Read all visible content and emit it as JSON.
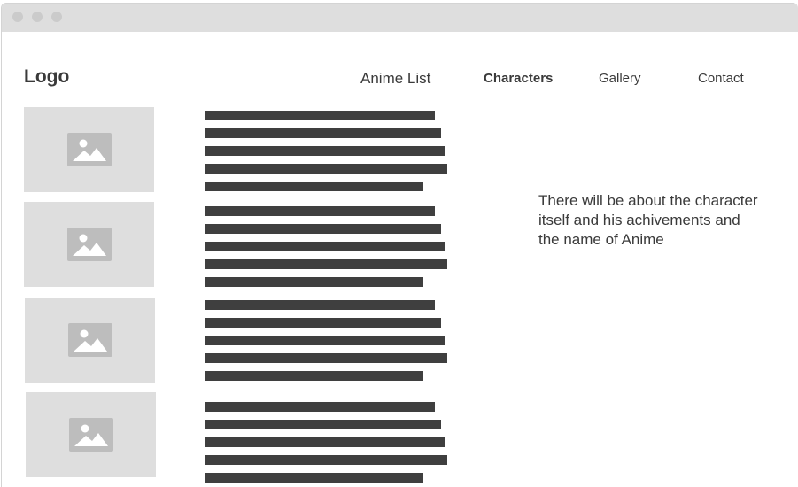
{
  "header": {
    "logo": "Logo",
    "nav": [
      {
        "label": "Anime List",
        "active": false
      },
      {
        "label": "Characters",
        "active": true
      },
      {
        "label": "Gallery",
        "active": false
      },
      {
        "label": "Contact",
        "active": false
      }
    ]
  },
  "content": {
    "description": "There will be about the character itself and his achivements and the name of Anime",
    "items": [
      {
        "image": "image-placeholder-icon"
      },
      {
        "image": "image-placeholder-icon"
      },
      {
        "image": "image-placeholder-icon"
      },
      {
        "image": "image-placeholder-icon"
      }
    ]
  },
  "colors": {
    "placeholder": "#dedede",
    "text_bar": "#3f3f3f",
    "titlebar": "#dedede"
  }
}
